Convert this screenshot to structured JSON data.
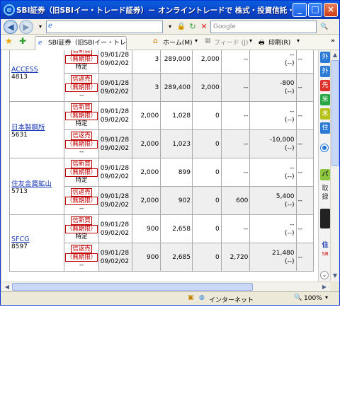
{
  "window": {
    "title": "SBI証券（旧SBIイー・トレード証券）－ オンライントレードで 株式・投資信託・債券を － Win...",
    "minimize": "_",
    "maximize": "□",
    "close": "×"
  },
  "toolbar": {
    "back": "◀",
    "forward": "▶",
    "address_value": "",
    "refresh": "↻",
    "stop": "✕",
    "lock": "🔒",
    "search_placeholder": "Google",
    "search_go": "🔍"
  },
  "commandbar": {
    "tab_label": "SBI証券（旧SBIイー・トレー...",
    "home": "ホーム(M)",
    "feed": "フィード (J)",
    "print": "印刷(R)",
    "more": "»"
  },
  "rows": [
    {
      "name": "ACCESS",
      "code": "4813",
      "sub": [
        {
          "type": "信新買",
          "term": "（無期限）",
          "acct": "特定",
          "d1": "09/01/28",
          "d2": "09/02/02",
          "qty": "3",
          "price": "289,000",
          "cur": "2,000",
          "val": "--",
          "pl1": "--",
          "pl2": "(--)",
          "last": "--"
        },
        {
          "type": "信返売",
          "term": "（無期限）",
          "acct": "--",
          "d1": "09/01/28",
          "d2": "09/02/02",
          "qty": "3",
          "price": "289,400",
          "cur": "2,000",
          "val": "--",
          "pl1": "-800",
          "pl2": "(--)",
          "last": "--"
        }
      ]
    },
    {
      "name": "日本製鋼所",
      "code": "5631",
      "sub": [
        {
          "type": "信新買",
          "term": "（無期限）",
          "acct": "特定",
          "d1": "09/01/28",
          "d2": "09/02/02",
          "qty": "2,000",
          "price": "1,028",
          "cur": "0",
          "val": "--",
          "pl1": "--",
          "pl2": "(--)",
          "last": "--"
        },
        {
          "type": "信返売",
          "term": "（無期限）",
          "acct": "--",
          "d1": "09/01/28",
          "d2": "09/02/02",
          "qty": "2,000",
          "price": "1,023",
          "cur": "0",
          "val": "--",
          "pl1": "-10,000",
          "pl2": "(--)",
          "last": "--"
        }
      ]
    },
    {
      "name": "住友金属鉱山",
      "code": "5713",
      "sub": [
        {
          "type": "信新買",
          "term": "（無期限）",
          "acct": "特定",
          "d1": "09/01/28",
          "d2": "09/02/02",
          "qty": "2,000",
          "price": "899",
          "cur": "0",
          "val": "--",
          "pl1": "--",
          "pl2": "(--)",
          "last": "--"
        },
        {
          "type": "信返売",
          "term": "（無期限）",
          "acct": "--",
          "d1": "09/01/28",
          "d2": "09/02/02",
          "qty": "2,000",
          "price": "902",
          "cur": "0",
          "val": "600",
          "pl1": "5,400",
          "pl2": "(--)",
          "last": "--"
        }
      ]
    },
    {
      "name": "SFCG",
      "code": "8597",
      "sub": [
        {
          "type": "信新買",
          "term": "（無期限）",
          "acct": "特定",
          "d1": "09/01/28",
          "d2": "09/02/02",
          "qty": "900",
          "price": "2,658",
          "cur": "0",
          "val": "--",
          "pl1": "--",
          "pl2": "(--)",
          "last": "--"
        },
        {
          "type": "信返売",
          "term": "（無期限）",
          "acct": "--",
          "d1": "09/01/28",
          "d2": "09/02/02",
          "qty": "900",
          "price": "2,685",
          "cur": "0",
          "val": "2,720",
          "pl1": "21,480",
          "pl2": "(--)",
          "last": "--"
        }
      ]
    }
  ],
  "rightpanel": {
    "items": [
      {
        "label": "外",
        "color": "#2b7bd6"
      },
      {
        "label": "外",
        "color": "#2b7bd6"
      },
      {
        "label": "先",
        "color": "#e0322b"
      },
      {
        "label": "米",
        "color": "#28a745"
      },
      {
        "label": "未",
        "color": "#b6c21a"
      },
      {
        "label": "住",
        "color": "#2b7bd6"
      }
    ],
    "text1": "バ",
    "text2": "取",
    "text3": "録",
    "text4": "住",
    "text5": "SB"
  },
  "status": {
    "zone": "インターネット",
    "zoom": "100%"
  }
}
